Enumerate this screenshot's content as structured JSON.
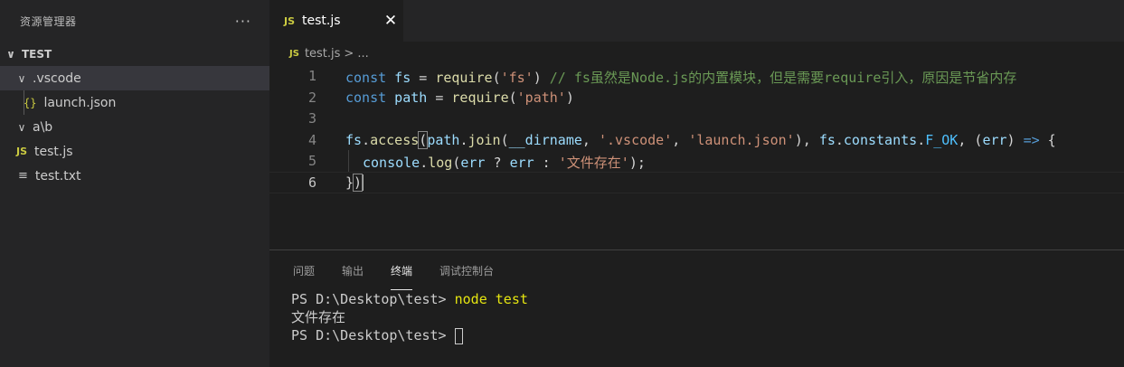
{
  "sidebar": {
    "title": "资源管理器",
    "more": "···",
    "root": "TEST",
    "items": [
      {
        "label": ".vscode",
        "chevron": "∨",
        "type": "folder"
      },
      {
        "label": "launch.json",
        "icon": "{}",
        "type": "json"
      },
      {
        "label": "a\\b",
        "chevron": "∨",
        "type": "folder"
      },
      {
        "label": "test.js",
        "icon": "JS",
        "type": "js"
      },
      {
        "label": "test.txt",
        "icon": "≡",
        "type": "txt"
      }
    ]
  },
  "editor": {
    "tab": {
      "icon": "JS",
      "name": "test.js",
      "close": "✕"
    },
    "breadcrumb": {
      "icon": "JS",
      "file": "test.js",
      "sep": ">",
      "rest": "..."
    },
    "lines": [
      {
        "n": "1",
        "t1": "const",
        "t2": " fs",
        "t3": " = ",
        "t4": "require",
        "t5": "(",
        "t6": "'fs'",
        "t7": ") ",
        "t8": "// fs虽然是Node.js的内置模块，但是需要require引入，原因是节省内存"
      },
      {
        "n": "2",
        "t1": "const",
        "t2": " path",
        "t3": " = ",
        "t4": "require",
        "t5": "(",
        "t6": "'path'",
        "t7": ")"
      },
      {
        "n": "3"
      },
      {
        "n": "4",
        "a1": "fs",
        "a2": ".",
        "a3": "access",
        "a4": "(",
        "a5": "path",
        "a6": ".",
        "a7": "join",
        "a8": "(",
        "a9": "__dirname",
        "a10": ", ",
        "a11": "'.vscode'",
        "a12": ", ",
        "a13": "'launch.json'",
        "a14": "), ",
        "a15": "fs",
        "a16": ".",
        "a17": "constants",
        "a18": ".",
        "a19": "F_OK",
        "a20": ", (",
        "a21": "err",
        "a22": ") ",
        "a23": "=>",
        "a24": " {"
      },
      {
        "n": "5",
        "b1": "console",
        "b2": ".",
        "b3": "log",
        "b4": "(",
        "b5": "err",
        "b6": " ? ",
        "b7": "err",
        "b8": " : ",
        "b9": "'文件存在'",
        "b10": ");"
      },
      {
        "n": "6",
        "c1": "}",
        "c2": ")"
      }
    ]
  },
  "panel": {
    "tabs": [
      "问题",
      "输出",
      "终端",
      "调试控制台"
    ],
    "active_tab": "终端",
    "terminal": {
      "prompt1": "PS D:\\Desktop\\test> ",
      "cmd1": "node test",
      "output": "文件存在",
      "prompt2": "PS D:\\Desktop\\test> "
    }
  },
  "colors": {
    "keyword": "#569cd6",
    "variable": "#9cdcfe",
    "function": "#dcdcaa",
    "string": "#ce9178",
    "comment": "#6a9955",
    "js_icon": "#cbcb41"
  }
}
